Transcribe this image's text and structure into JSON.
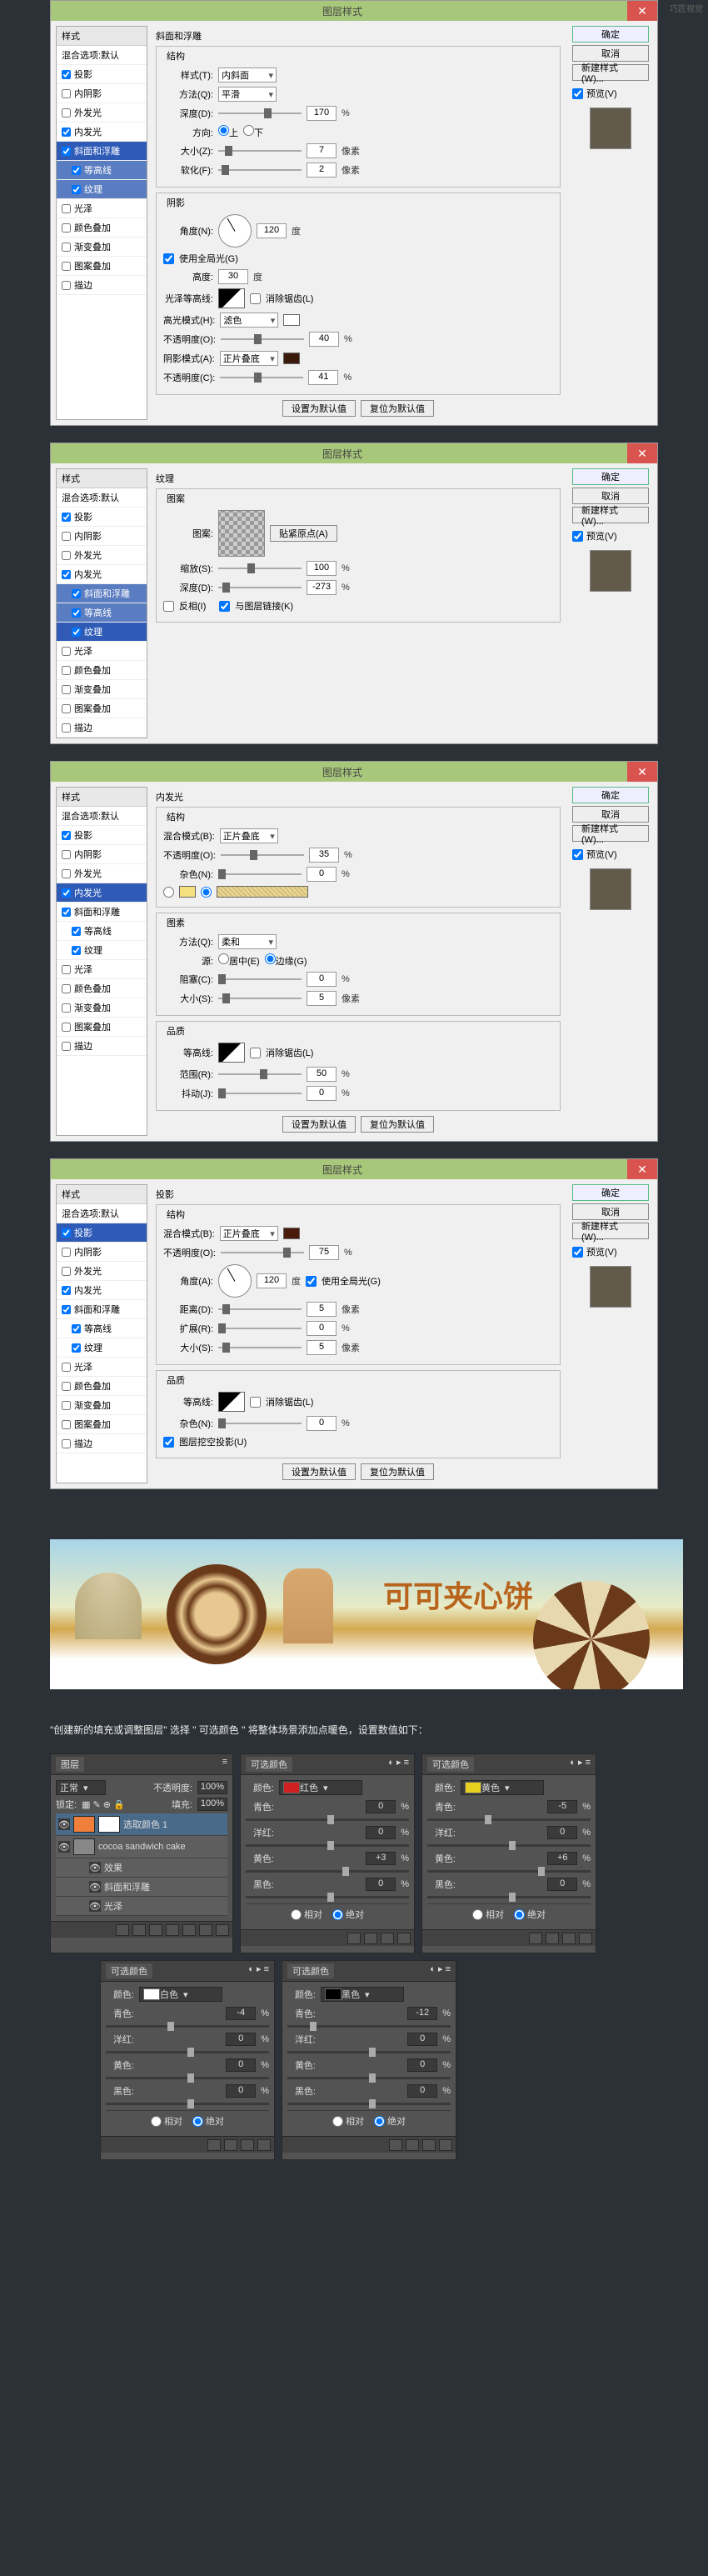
{
  "watermark": "巧匠视觉",
  "dialogs": [
    {
      "title": "图层样式",
      "styles": {
        "header": "样式",
        "sub": "混合选项:默认",
        "items": [
          "投影",
          "内阴影",
          "外发光",
          "内发光",
          "斜面和浮雕",
          "等高线",
          "纹理",
          "光泽",
          "颜色叠加",
          "渐变叠加",
          "图案叠加",
          "描边"
        ],
        "checked": [
          true,
          false,
          false,
          true,
          true,
          true,
          true,
          false,
          false,
          false,
          false,
          false
        ],
        "selected": 4,
        "subSelected": [
          5,
          6
        ]
      },
      "rightButtons": [
        "确定",
        "取消",
        "新建样式(W)..."
      ],
      "preview": "预览(V)",
      "content": {
        "title": "斜面和浮雕",
        "sections": [
          {
            "name": "结构",
            "rows": [
              {
                "label": "样式(T):",
                "type": "select",
                "value": "内斜面"
              },
              {
                "label": "方法(Q):",
                "type": "select",
                "value": "平滑"
              },
              {
                "label": "深度(D):",
                "type": "slider",
                "value": "170",
                "unit": "%",
                "pos": "55%"
              },
              {
                "label": "方向:",
                "type": "radios",
                "opts": [
                  "上",
                  "下"
                ],
                "sel": 0
              },
              {
                "label": "大小(Z):",
                "type": "slider",
                "value": "7",
                "unit": "像素",
                "pos": "8%"
              },
              {
                "label": "软化(F):",
                "type": "slider",
                "value": "2",
                "unit": "像素",
                "pos": "4%"
              }
            ]
          },
          {
            "name": "阴影",
            "rows": [
              {
                "label": "角度(N):",
                "type": "angle",
                "value": "120",
                "unit": "度"
              },
              {
                "label": "",
                "type": "check",
                "value": "使用全局光(G)",
                "checked": true
              },
              {
                "label": "高度:",
                "type": "num",
                "value": "30",
                "unit": "度"
              },
              {
                "label": "光泽等高线:",
                "type": "contour",
                "check": "消除锯齿(L)",
                "checked": false
              },
              {
                "label": "高光模式(H):",
                "type": "select-swatch",
                "value": "滤色",
                "swatch": "#ffffff"
              },
              {
                "label": "不透明度(O):",
                "type": "slider",
                "value": "40",
                "unit": "%",
                "pos": "40%"
              },
              {
                "label": "阴影模式(A):",
                "type": "select-swatch",
                "value": "正片叠底",
                "swatch": "#3a1a0a"
              },
              {
                "label": "不透明度(C):",
                "type": "slider",
                "value": "41",
                "unit": "%",
                "pos": "41%"
              }
            ]
          }
        ],
        "buttons": [
          "设置为默认值",
          "复位为默认值"
        ]
      }
    },
    {
      "title": "图层样式",
      "styles": {
        "header": "样式",
        "sub": "混合选项:默认",
        "items": [
          "投影",
          "内阴影",
          "外发光",
          "内发光",
          "斜面和浮雕",
          "等高线",
          "纹理",
          "光泽",
          "颜色叠加",
          "渐变叠加",
          "图案叠加",
          "描边"
        ],
        "checked": [
          true,
          false,
          false,
          true,
          true,
          true,
          true,
          false,
          false,
          false,
          false,
          false
        ],
        "selected": 6,
        "subSelected": [
          4,
          5
        ]
      },
      "rightButtons": [
        "确定",
        "取消",
        "新建样式(W)..."
      ],
      "preview": "预览(V)",
      "content": {
        "title": "纹理",
        "sections": [
          {
            "name": "图案",
            "rows": [
              {
                "label": "图案:",
                "type": "pattern",
                "btn": "贴紧原点(A)"
              },
              {
                "label": "缩放(S):",
                "type": "slider",
                "value": "100",
                "unit": "%",
                "pos": "35%"
              },
              {
                "label": "深度(D):",
                "type": "slider",
                "value": "-273",
                "unit": "%",
                "pos": "5%"
              },
              {
                "label": "",
                "type": "checks",
                "opts": [
                  {
                    "t": "反相(I)",
                    "c": false
                  },
                  {
                    "t": "与图层链接(K)",
                    "c": true
                  }
                ]
              }
            ]
          }
        ]
      }
    },
    {
      "title": "图层样式",
      "styles": {
        "header": "样式",
        "sub": "混合选项:默认",
        "items": [
          "投影",
          "内阴影",
          "外发光",
          "内发光",
          "斜面和浮雕",
          "等高线",
          "纹理",
          "光泽",
          "颜色叠加",
          "渐变叠加",
          "图案叠加",
          "描边"
        ],
        "checked": [
          true,
          false,
          false,
          true,
          true,
          true,
          true,
          false,
          false,
          false,
          false,
          false
        ],
        "selected": 3
      },
      "rightButtons": [
        "确定",
        "取消",
        "新建样式(W)..."
      ],
      "preview": "预览(V)",
      "content": {
        "title": "内发光",
        "sections": [
          {
            "name": "结构",
            "rows": [
              {
                "label": "混合模式(B):",
                "type": "select",
                "value": "正片叠底"
              },
              {
                "label": "不透明度(O):",
                "type": "slider",
                "value": "35",
                "unit": "%",
                "pos": "35%"
              },
              {
                "label": "杂色(N):",
                "type": "slider",
                "value": "0",
                "unit": "%",
                "pos": "0%"
              },
              {
                "label": "",
                "type": "radio-gradient",
                "swatch": "#f5e080"
              }
            ]
          },
          {
            "name": "图素",
            "rows": [
              {
                "label": "方法(Q):",
                "type": "select",
                "value": "柔和"
              },
              {
                "label": "源:",
                "type": "radios",
                "opts": [
                  "居中(E)",
                  "边缘(G)"
                ],
                "sel": 1
              },
              {
                "label": "阻塞(C):",
                "type": "slider",
                "value": "0",
                "unit": "%",
                "pos": "0%"
              },
              {
                "label": "大小(S):",
                "type": "slider",
                "value": "5",
                "unit": "像素",
                "pos": "5%"
              }
            ]
          },
          {
            "name": "品质",
            "rows": [
              {
                "label": "等高线:",
                "type": "contour",
                "check": "消除锯齿(L)",
                "checked": false
              },
              {
                "label": "范围(R):",
                "type": "slider",
                "value": "50",
                "unit": "%",
                "pos": "50%"
              },
              {
                "label": "抖动(J):",
                "type": "slider",
                "value": "0",
                "unit": "%",
                "pos": "0%"
              }
            ]
          }
        ],
        "buttons": [
          "设置为默认值",
          "复位为默认值"
        ]
      }
    },
    {
      "title": "图层样式",
      "styles": {
        "header": "样式",
        "sub": "混合选项:默认",
        "items": [
          "投影",
          "内阴影",
          "外发光",
          "内发光",
          "斜面和浮雕",
          "等高线",
          "纹理",
          "光泽",
          "颜色叠加",
          "渐变叠加",
          "图案叠加",
          "描边"
        ],
        "checked": [
          true,
          false,
          false,
          true,
          true,
          true,
          true,
          false,
          false,
          false,
          false,
          false
        ],
        "selected": 0
      },
      "rightButtons": [
        "确定",
        "取消",
        "新建样式(W)..."
      ],
      "preview": "预览(V)",
      "content": {
        "title": "投影",
        "sections": [
          {
            "name": "结构",
            "rows": [
              {
                "label": "混合模式(B):",
                "type": "select-swatch",
                "value": "正片叠底",
                "swatch": "#4a1a0a"
              },
              {
                "label": "不透明度(O):",
                "type": "slider",
                "value": "75",
                "unit": "%",
                "pos": "75%"
              },
              {
                "label": "角度(A):",
                "type": "angle",
                "value": "120",
                "unit": "度",
                "check": "使用全局光(G)",
                "checked": true
              },
              {
                "label": "距离(D):",
                "type": "slider",
                "value": "5",
                "unit": "像素",
                "pos": "5%"
              },
              {
                "label": "扩展(R):",
                "type": "slider",
                "value": "0",
                "unit": "%",
                "pos": "0%"
              },
              {
                "label": "大小(S):",
                "type": "slider",
                "value": "5",
                "unit": "像素",
                "pos": "5%"
              }
            ]
          },
          {
            "name": "品质",
            "rows": [
              {
                "label": "等高线:",
                "type": "contour",
                "check": "消除锯齿(L)",
                "checked": false
              },
              {
                "label": "杂色(N):",
                "type": "slider",
                "value": "0",
                "unit": "%",
                "pos": "0%"
              },
              {
                "label": "",
                "type": "check",
                "value": "图层挖空投影(U)",
                "checked": true
              }
            ]
          }
        ],
        "buttons": [
          "设置为默认值",
          "复位为默认值"
        ]
      }
    }
  ],
  "bannerText": "可可夹心饼",
  "caption": "\"创建新的填充或调整图层\" 选择 \" 可选颜色 \" 将整体场景添加点暖色，设置数值如下：",
  "layersPanel": {
    "tab": "图层",
    "mode": "正常",
    "opacity": "不透明度:",
    "opacityVal": "100%",
    "lock": "锁定:",
    "fill": "填充:",
    "fillVal": "100%",
    "layers": [
      {
        "name": "选取颜色 1",
        "sel": true,
        "mask": true
      },
      {
        "name": "cocoa sandwich cake",
        "sel": false
      },
      {
        "name": "效果",
        "fx": true
      },
      {
        "name": "斜面和浮雕",
        "fx": true
      },
      {
        "name": "光泽",
        "fx": true
      }
    ]
  },
  "scPanels": [
    {
      "title": "可选颜色",
      "colorLabel": "颜色:",
      "color": "红色",
      "swatch": "#d02020",
      "rows": [
        {
          "l": "青色:",
          "v": "0"
        },
        {
          "l": "洋红:",
          "v": "0"
        },
        {
          "l": "黄色:",
          "v": "+3"
        },
        {
          "l": "黑色:",
          "v": "0"
        }
      ],
      "radios": [
        "相对",
        "绝对"
      ],
      "sel": 1
    },
    {
      "title": "可选颜色",
      "colorLabel": "颜色:",
      "color": "黄色",
      "swatch": "#e8d020",
      "rows": [
        {
          "l": "青色:",
          "v": "-5"
        },
        {
          "l": "洋红:",
          "v": "0"
        },
        {
          "l": "黄色:",
          "v": "+6"
        },
        {
          "l": "黑色:",
          "v": "0"
        }
      ],
      "radios": [
        "相对",
        "绝对"
      ],
      "sel": 1
    },
    {
      "title": "可选颜色",
      "colorLabel": "颜色:",
      "color": "白色",
      "swatch": "#ffffff",
      "rows": [
        {
          "l": "青色:",
          "v": "-4"
        },
        {
          "l": "洋红:",
          "v": "0"
        },
        {
          "l": "黄色:",
          "v": "0"
        },
        {
          "l": "黑色:",
          "v": "0"
        }
      ],
      "radios": [
        "相对",
        "绝对"
      ],
      "sel": 1
    },
    {
      "title": "可选颜色",
      "colorLabel": "颜色:",
      "color": "黑色",
      "swatch": "#000000",
      "rows": [
        {
          "l": "青色:",
          "v": "-12"
        },
        {
          "l": "洋红:",
          "v": "0"
        },
        {
          "l": "黄色:",
          "v": "0"
        },
        {
          "l": "黑色:",
          "v": "0"
        }
      ],
      "radios": [
        "相对",
        "绝对"
      ],
      "sel": 1
    }
  ]
}
